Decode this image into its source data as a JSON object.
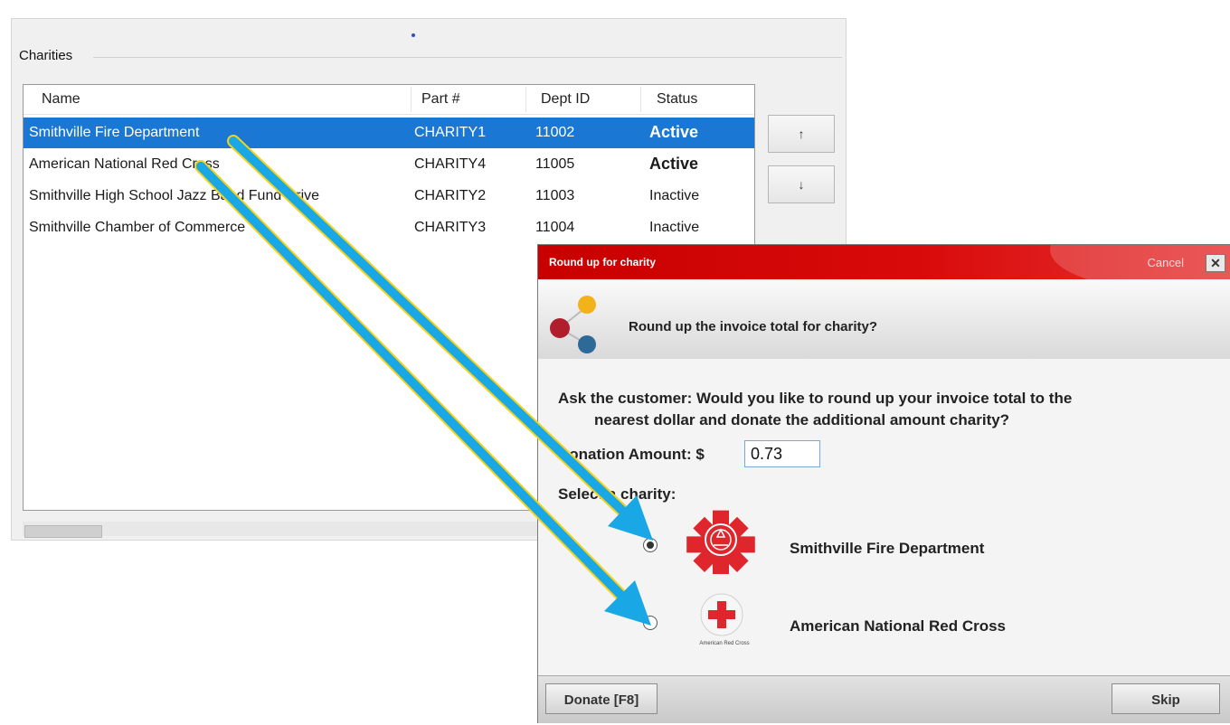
{
  "charities_panel": {
    "group_label": "Charities",
    "columns": [
      "Name",
      "Part #",
      "Dept ID",
      "Status"
    ],
    "rows": [
      {
        "name": "Smithville Fire Department",
        "part": "CHARITY1",
        "dept": "11002",
        "status": "Active",
        "selected": true
      },
      {
        "name": "American National Red Cross",
        "part": "CHARITY4",
        "dept": "11005",
        "status": "Active",
        "selected": false
      },
      {
        "name": "Smithville High School Jazz Band Fund Drive",
        "part": "CHARITY2",
        "dept": "11003",
        "status": "Inactive",
        "selected": false
      },
      {
        "name": "Smithville Chamber of Commerce",
        "part": "CHARITY3",
        "dept": "11004",
        "status": "Inactive",
        "selected": false
      }
    ],
    "move_up_label": "↑",
    "move_down_label": "↓"
  },
  "dialog": {
    "title": "Round up for charity",
    "cancel_label": "Cancel",
    "close_label": "✕",
    "question": "Round up the invoice total for charity?",
    "ask_line1": "Ask the customer: Would you like to round up your invoice total to the",
    "ask_line2": "nearest dollar and donate the additional amount charity?",
    "amount_label": "Donation Amount: $",
    "amount_value": "0.73",
    "select_label": "Select a charity:",
    "options": [
      {
        "name": "Smithville Fire Department",
        "checked": true,
        "icon": "fire-department-icon"
      },
      {
        "name": "American National Red Cross",
        "checked": false,
        "icon": "red-cross-icon"
      }
    ],
    "red_cross_caption": "American Red Cross",
    "donate_label": "Donate [F8]",
    "skip_label": "Skip"
  },
  "colors": {
    "selection": "#1a78d4",
    "title_bar": "#d00000",
    "arrow": "#1aa7e6",
    "arrow_edge": "#f2d21a",
    "fire_logo": "#e0262d"
  }
}
